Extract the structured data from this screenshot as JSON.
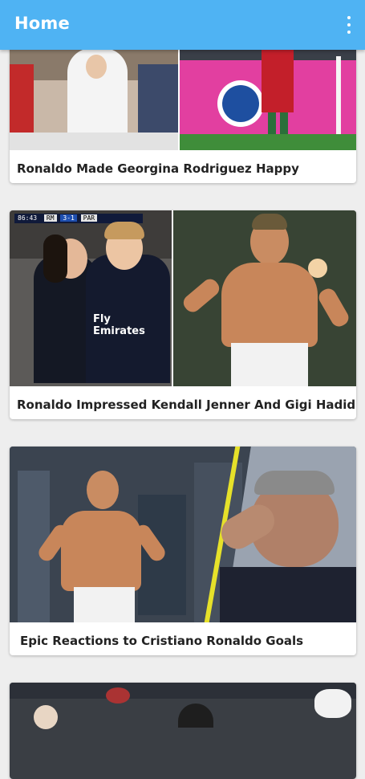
{
  "appbar": {
    "title": "Home",
    "menu_icon": "more-vert-icon"
  },
  "cards": [
    {
      "title": "Ronaldo Made Georgina Rodriguez Happy"
    },
    {
      "title": "Ronaldo Impressed Kendall Jenner And Gigi Hadid"
    },
    {
      "title": "Epic Reactions to Cristiano Ronaldo Goals"
    },
    {
      "title": ""
    }
  ],
  "card2_overlay": {
    "clock": "86:43",
    "team_home": "RM",
    "score": "3-1",
    "team_away": "PAR",
    "shirt_text": "Fly Emirates"
  }
}
